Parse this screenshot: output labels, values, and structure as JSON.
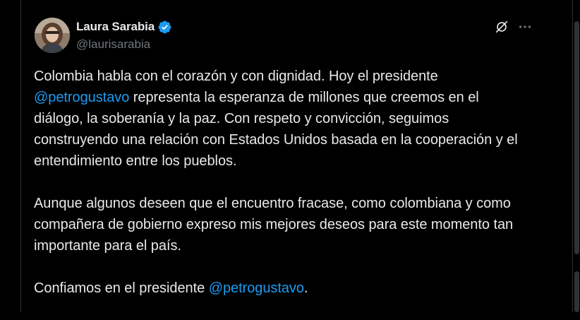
{
  "tweet": {
    "author": {
      "display_name": "Laura Sarabia",
      "handle": "@laurisarabia",
      "verified": true
    },
    "paragraphs": [
      {
        "parts": [
          {
            "text": "Colombia habla con el corazón y con dignidad. Hoy el presidente ",
            "type": "text"
          },
          {
            "text": "@petrogustavo",
            "type": "mention"
          },
          {
            "text": " representa la esperanza de millones que creemos en el diálogo, la soberanía y la paz. Con respeto y convicción, seguimos construyendo una relación con Estados Unidos basada en la cooperación y el entendimiento entre los pueblos.",
            "type": "text"
          }
        ]
      },
      {
        "parts": [
          {
            "text": "Aunque algunos deseen que el encuentro fracase, como colombiana y como compañera de gobierno expreso mis mejores deseos para este momento tan importante para el país.",
            "type": "text"
          }
        ]
      },
      {
        "parts": [
          {
            "text": "Confiamos en el presidente ",
            "type": "text"
          },
          {
            "text": "@petrogustavo",
            "type": "mention"
          },
          {
            "text": ".",
            "type": "text"
          }
        ]
      }
    ],
    "icons": {
      "verified": "verified-badge-icon",
      "grok": "grok-icon",
      "more": "more-options-icon"
    },
    "colors": {
      "background": "#000000",
      "text": "#e7e9ea",
      "secondary": "#71767b",
      "accent": "#1d9bf0"
    }
  }
}
